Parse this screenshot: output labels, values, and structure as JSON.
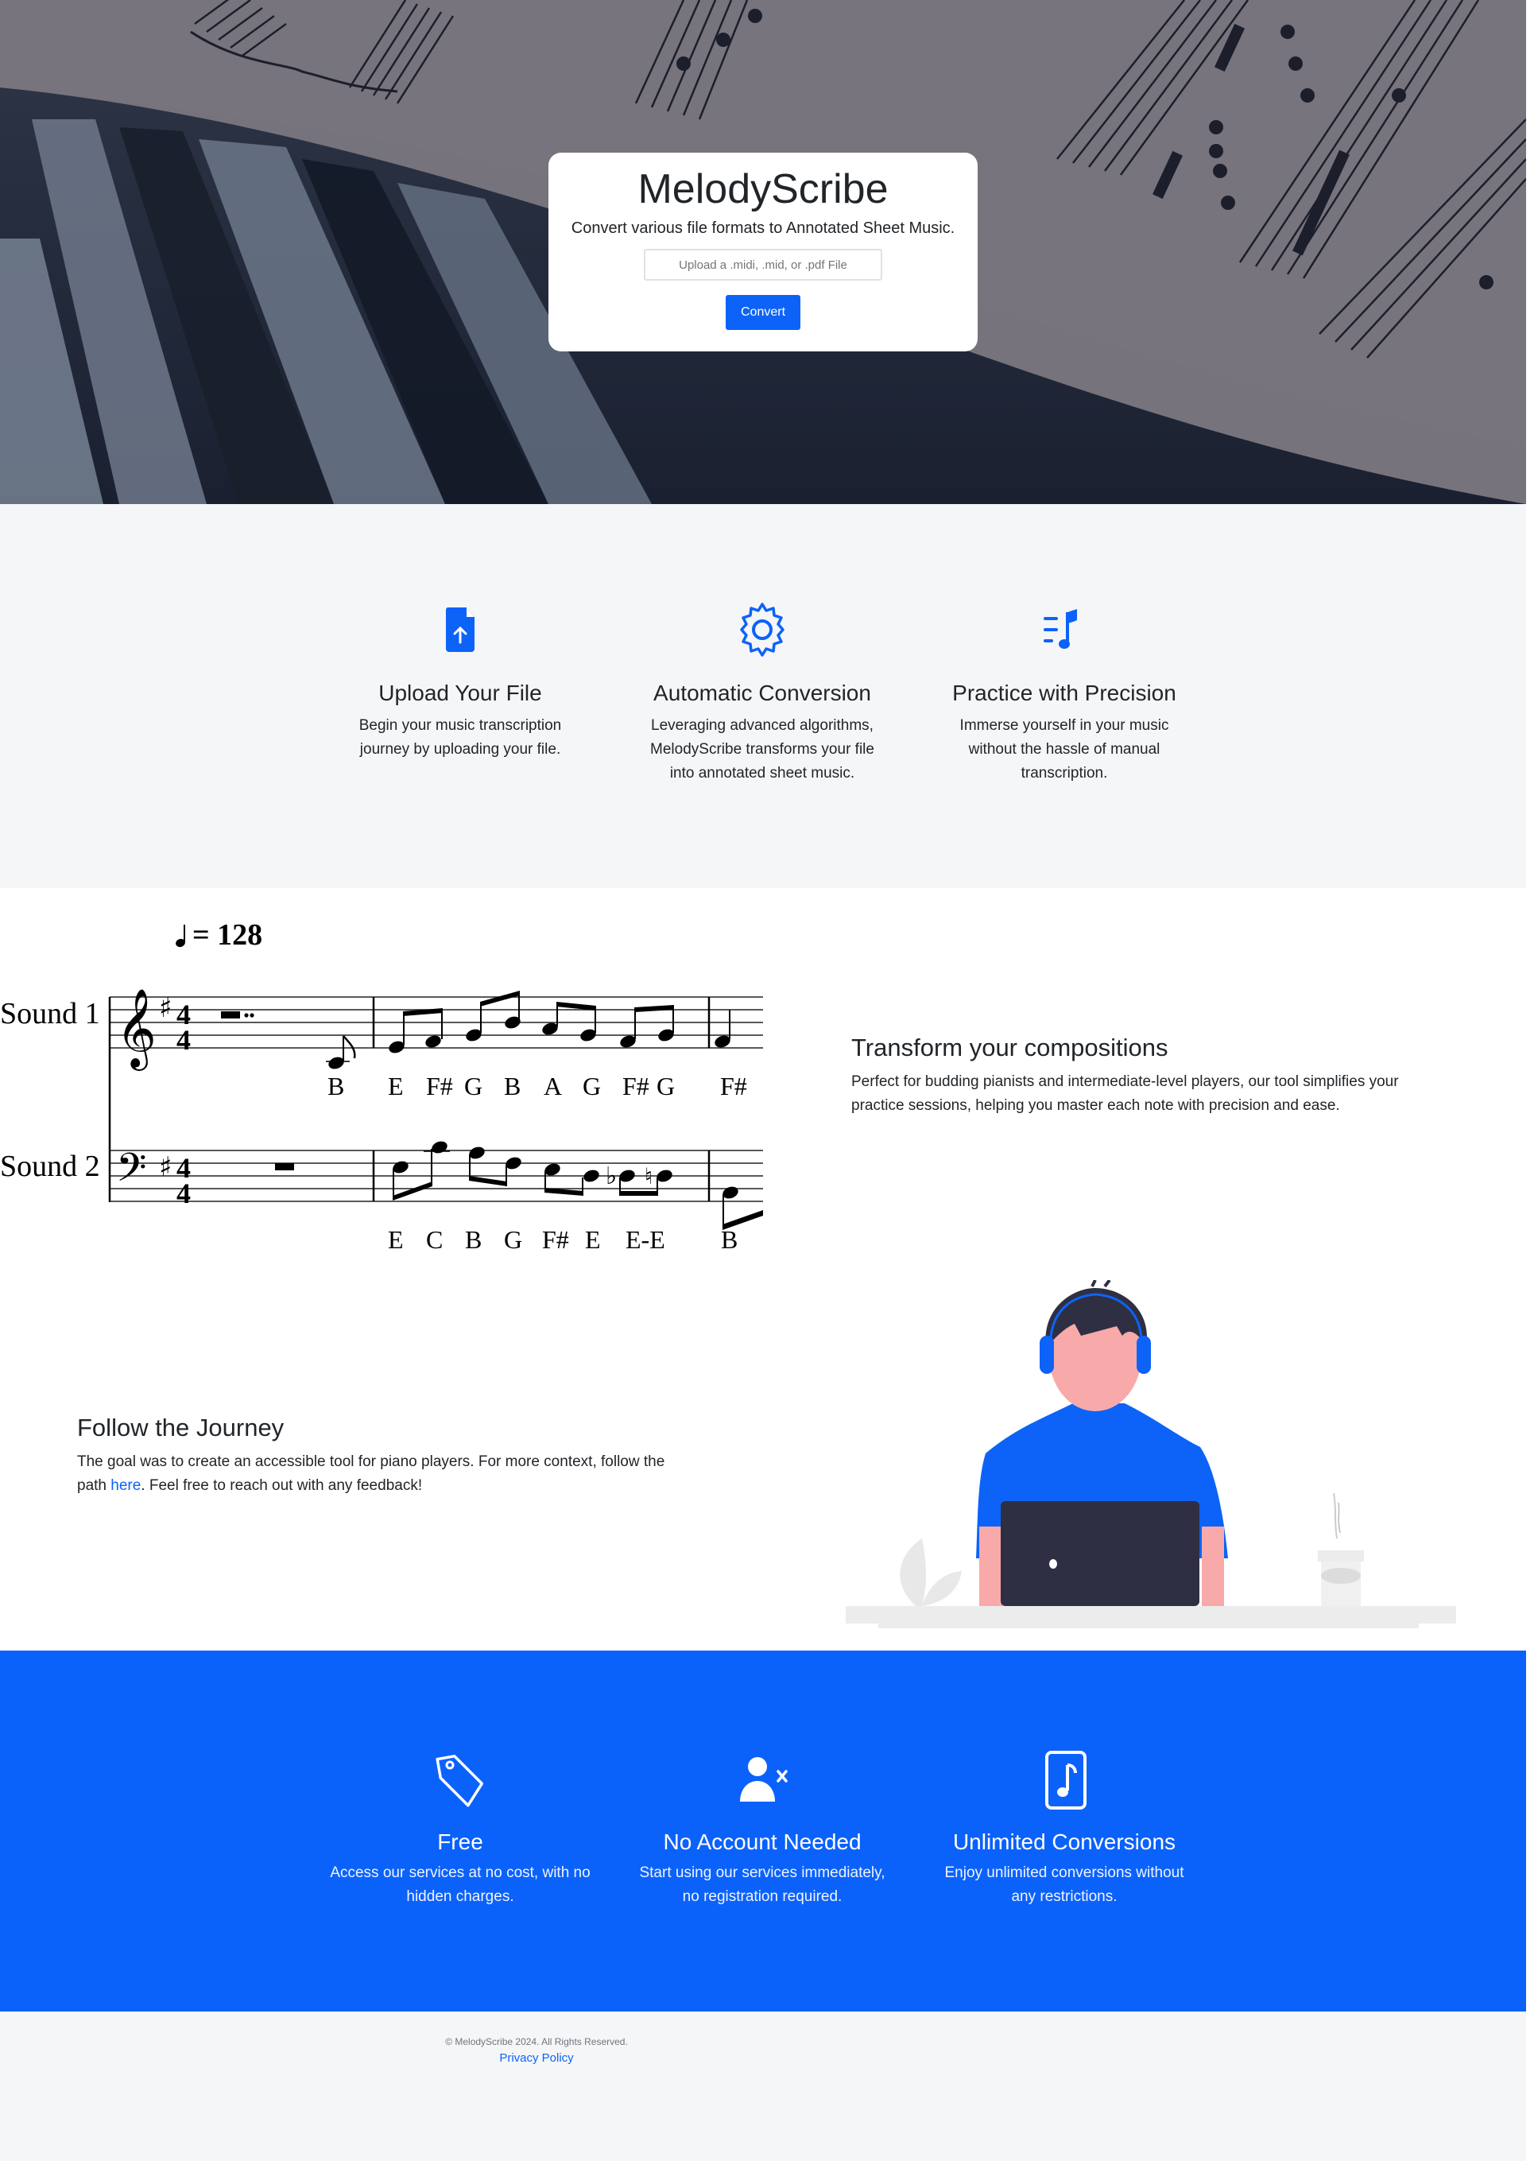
{
  "hero": {
    "title": "MelodyScribe",
    "subtitle": "Convert various file formats to Annotated Sheet Music.",
    "upload_placeholder": "Upload a .midi, .mid, or .pdf File",
    "convert_label": "Convert"
  },
  "features": [
    {
      "icon": "file-upload-icon",
      "title": "Upload Your File",
      "text": "Begin your music transcription journey by uploading your file."
    },
    {
      "icon": "gear-icon",
      "title": "Automatic Conversion",
      "text": "Leveraging advanced algorithms, MelodyScribe transforms your file into annotated sheet music."
    },
    {
      "icon": "music-playlist-icon",
      "title": "Practice with Precision",
      "text": "Immerse yourself in your music without the hassle of manual transcription."
    }
  ],
  "score": {
    "tempo": "= 128",
    "staves": [
      {
        "label": "Sound 1",
        "clef": "treble",
        "note_names": [
          "B",
          "E",
          "F#",
          "G",
          "B",
          "A",
          "G",
          "F#",
          "G",
          "F#"
        ]
      },
      {
        "label": "Sound 2",
        "clef": "bass",
        "note_names": [
          "E",
          "C",
          "B",
          "G",
          "F#",
          "E",
          "E-E",
          "B"
        ]
      }
    ],
    "time_signature": "4/4",
    "key_signature": "1 sharp"
  },
  "transform": {
    "title": "Transform your compositions",
    "text": "Perfect for budding pianists and intermediate-level players, our tool simplifies your practice sessions, helping you master each note with precision and ease."
  },
  "journey": {
    "title": "Follow the Journey",
    "text_before": "The goal was to create an accessible tool for piano players. For more context, follow the path ",
    "link_label": "here",
    "text_after": ". Feel free to reach out with any feedback!"
  },
  "benefits": [
    {
      "icon": "tag-icon",
      "title": "Free",
      "text": "Access our services at no cost, with no hidden charges."
    },
    {
      "icon": "user-x-icon",
      "title": "No Account Needed",
      "text": "Start using our services immediately, no registration required."
    },
    {
      "icon": "music-file-icon",
      "title": "Unlimited Conversions",
      "text": "Enjoy unlimited conversions without any restrictions."
    }
  ],
  "footer": {
    "copyright": "© MelodyScribe 2024. All Rights Reserved.",
    "privacy_label": "Privacy Policy"
  },
  "colors": {
    "primary": "#0d63f8",
    "benefits_bg": "#0b62fb",
    "light_bg": "#f5f6f8",
    "text": "#212529"
  }
}
